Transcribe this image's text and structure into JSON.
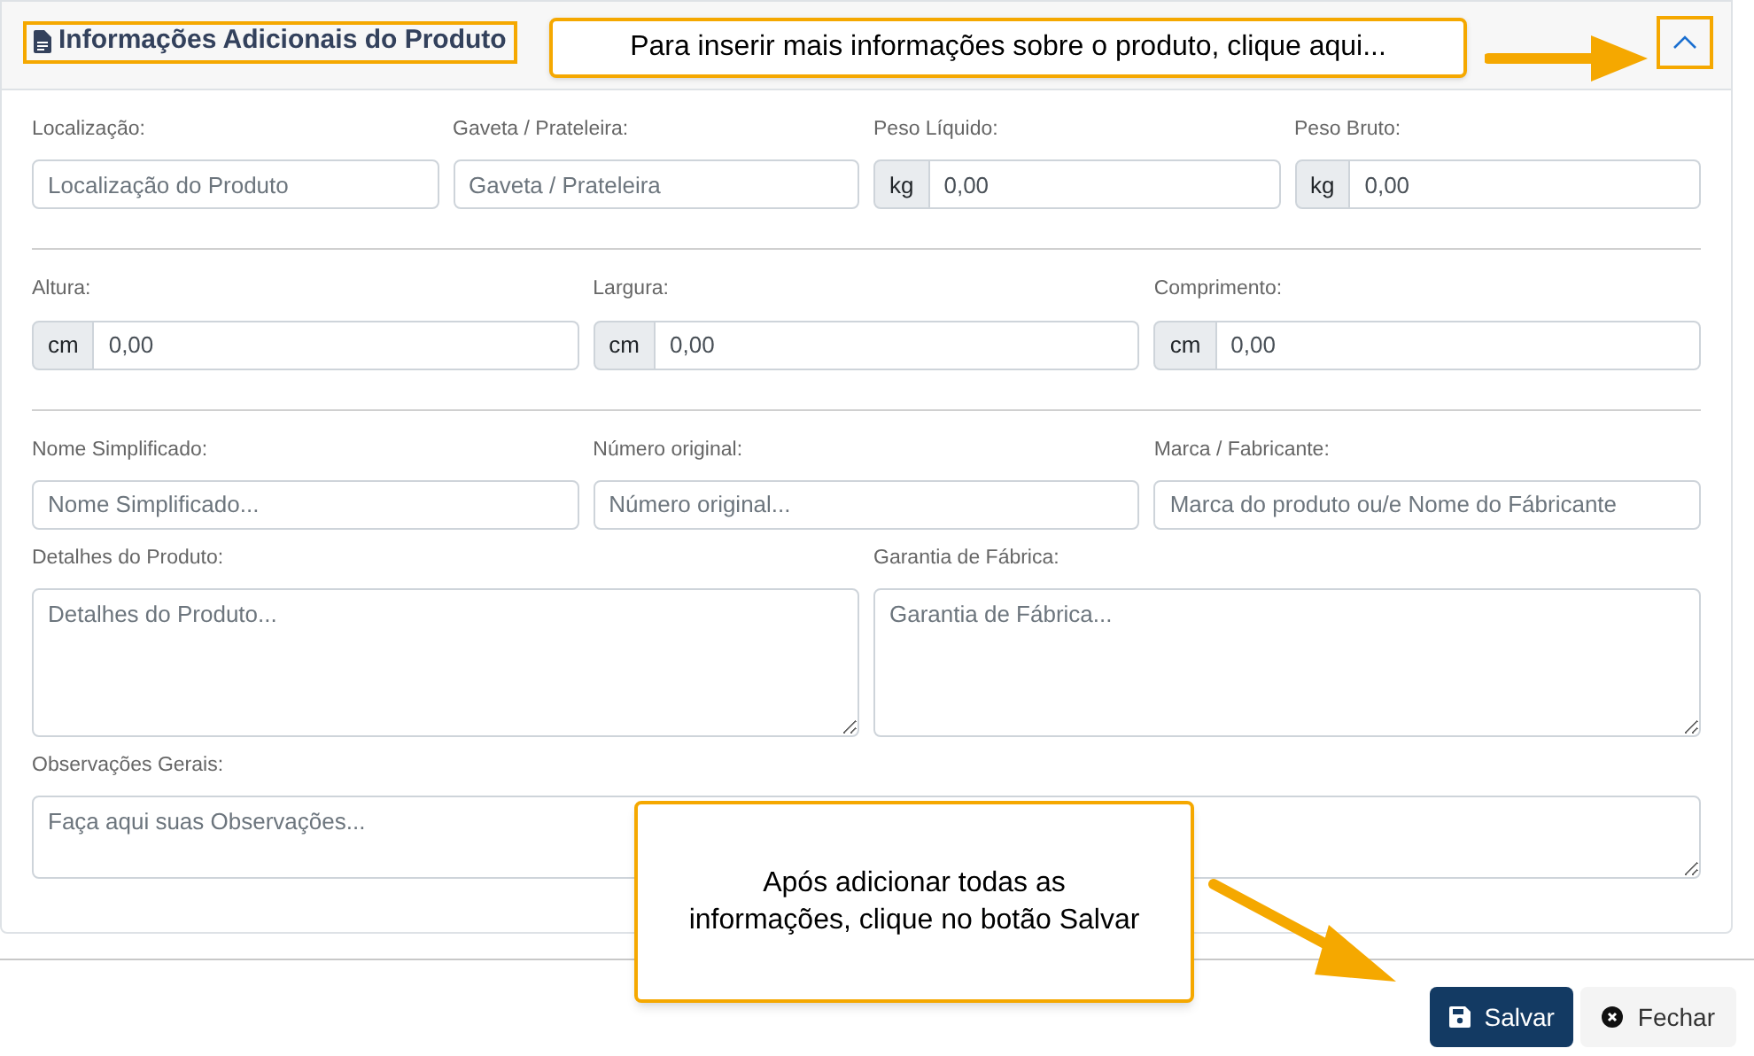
{
  "panel": {
    "title": "Informações Adicionais do Produto",
    "expanded": true
  },
  "sections": [
    {
      "rows": [
        [
          {
            "kind": "text",
            "label": "Localização:",
            "placeholder": "Localização do Produto"
          },
          {
            "kind": "text",
            "label": "Gaveta / Prateleira:",
            "placeholder": "Gaveta / Prateleira"
          },
          {
            "kind": "unit",
            "label": "Peso Líquido:",
            "unit": "kg",
            "value": "0,00"
          },
          {
            "kind": "unit",
            "label": "Peso Bruto:",
            "unit": "kg",
            "value": "0,00"
          }
        ]
      ]
    },
    {
      "rows": [
        [
          {
            "kind": "unit",
            "label": "Altura:",
            "unit": "cm",
            "value": "0,00"
          },
          {
            "kind": "unit",
            "label": "Largura:",
            "unit": "cm",
            "value": "0,00"
          },
          {
            "kind": "unit",
            "label": "Comprimento:",
            "unit": "cm",
            "value": "0,00"
          }
        ]
      ]
    },
    {
      "rows": [
        [
          {
            "kind": "text",
            "label": "Nome Simplificado:",
            "placeholder": "Nome Simplificado..."
          },
          {
            "kind": "text",
            "label": "Número original:",
            "placeholder": "Número original..."
          },
          {
            "kind": "text",
            "label": "Marca / Fabricante:",
            "placeholder": "Marca do produto ou/e Nome do Fábricante"
          }
        ],
        [
          {
            "kind": "textarea",
            "label": "Detalhes do Produto:",
            "placeholder": "Detalhes do Produto..."
          },
          {
            "kind": "textarea",
            "label": "Garantia de Fábrica:",
            "placeholder": "Garantia de Fábrica..."
          }
        ],
        [
          {
            "kind": "short-textarea",
            "label": "Observações Gerais:",
            "placeholder": "Faça aqui suas Observações..."
          }
        ]
      ]
    }
  ],
  "callouts": [
    {
      "text": "Para inserir mais informações sobre o produto, clique aqui..."
    },
    {
      "text": "Após adicionar todas as informações, clique no botão Salvar"
    }
  ],
  "buttons": [
    {
      "kind": "primary",
      "label": "Salvar"
    },
    {
      "kind": "secondary",
      "label": "Fechar"
    }
  ]
}
